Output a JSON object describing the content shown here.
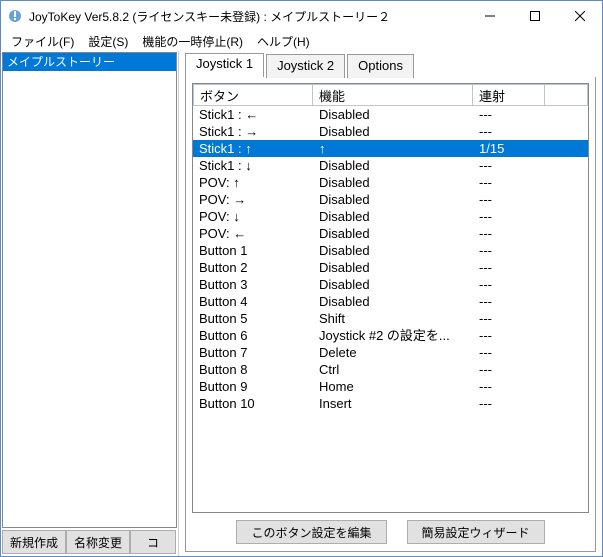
{
  "window": {
    "title": "JoyToKey Ver5.8.2 (ライセンスキー未登録) : メイプルストーリー２"
  },
  "menu": {
    "file": "ファイル(F)",
    "settings": "設定(S)",
    "pause": "機能の一時停止(R)",
    "help": "ヘルプ(H)"
  },
  "profiles": {
    "items": [
      {
        "name": "メイプルストーリー",
        "selected": true
      }
    ]
  },
  "sideButtons": {
    "new": "新規作成",
    "rename": "名称変更",
    "copy": "コ"
  },
  "tabs": {
    "items": [
      {
        "label": "Joystick 1",
        "active": true
      },
      {
        "label": "Joystick 2",
        "active": false
      },
      {
        "label": "Options",
        "active": false
      }
    ]
  },
  "listview": {
    "headers": {
      "button": "ボタン",
      "function": "機能",
      "rapid": "連射"
    },
    "rows": [
      {
        "b": "Stick1 : ←",
        "f": "Disabled",
        "r": "---",
        "sel": false
      },
      {
        "b": "Stick1 : →",
        "f": "Disabled",
        "r": "---",
        "sel": false
      },
      {
        "b": "Stick1 : ↑",
        "f": "↑",
        "r": "1/15",
        "sel": true
      },
      {
        "b": "Stick1 : ↓",
        "f": "Disabled",
        "r": "---",
        "sel": false
      },
      {
        "b": "POV: ↑",
        "f": "Disabled",
        "r": "---",
        "sel": false
      },
      {
        "b": "POV: →",
        "f": "Disabled",
        "r": "---",
        "sel": false
      },
      {
        "b": "POV: ↓",
        "f": "Disabled",
        "r": "---",
        "sel": false
      },
      {
        "b": "POV: ←",
        "f": "Disabled",
        "r": "---",
        "sel": false
      },
      {
        "b": "Button 1",
        "f": "Disabled",
        "r": "---",
        "sel": false
      },
      {
        "b": "Button 2",
        "f": "Disabled",
        "r": "---",
        "sel": false
      },
      {
        "b": "Button 3",
        "f": "Disabled",
        "r": "---",
        "sel": false
      },
      {
        "b": "Button 4",
        "f": "Disabled",
        "r": "---",
        "sel": false
      },
      {
        "b": "Button 5",
        "f": "Shift",
        "r": "---",
        "sel": false
      },
      {
        "b": "Button 6",
        "f": "Joystick #2 の設定を...",
        "r": "---",
        "sel": false
      },
      {
        "b": "Button 7",
        "f": "Delete",
        "r": "---",
        "sel": false
      },
      {
        "b": "Button 8",
        "f": "Ctrl",
        "r": "---",
        "sel": false
      },
      {
        "b": "Button 9",
        "f": "Home",
        "r": "---",
        "sel": false
      },
      {
        "b": "Button 10",
        "f": "Insert",
        "r": "---",
        "sel": false
      }
    ]
  },
  "bottomButtons": {
    "edit": "このボタン設定を編集",
    "wizard": "簡易設定ウィザード"
  }
}
